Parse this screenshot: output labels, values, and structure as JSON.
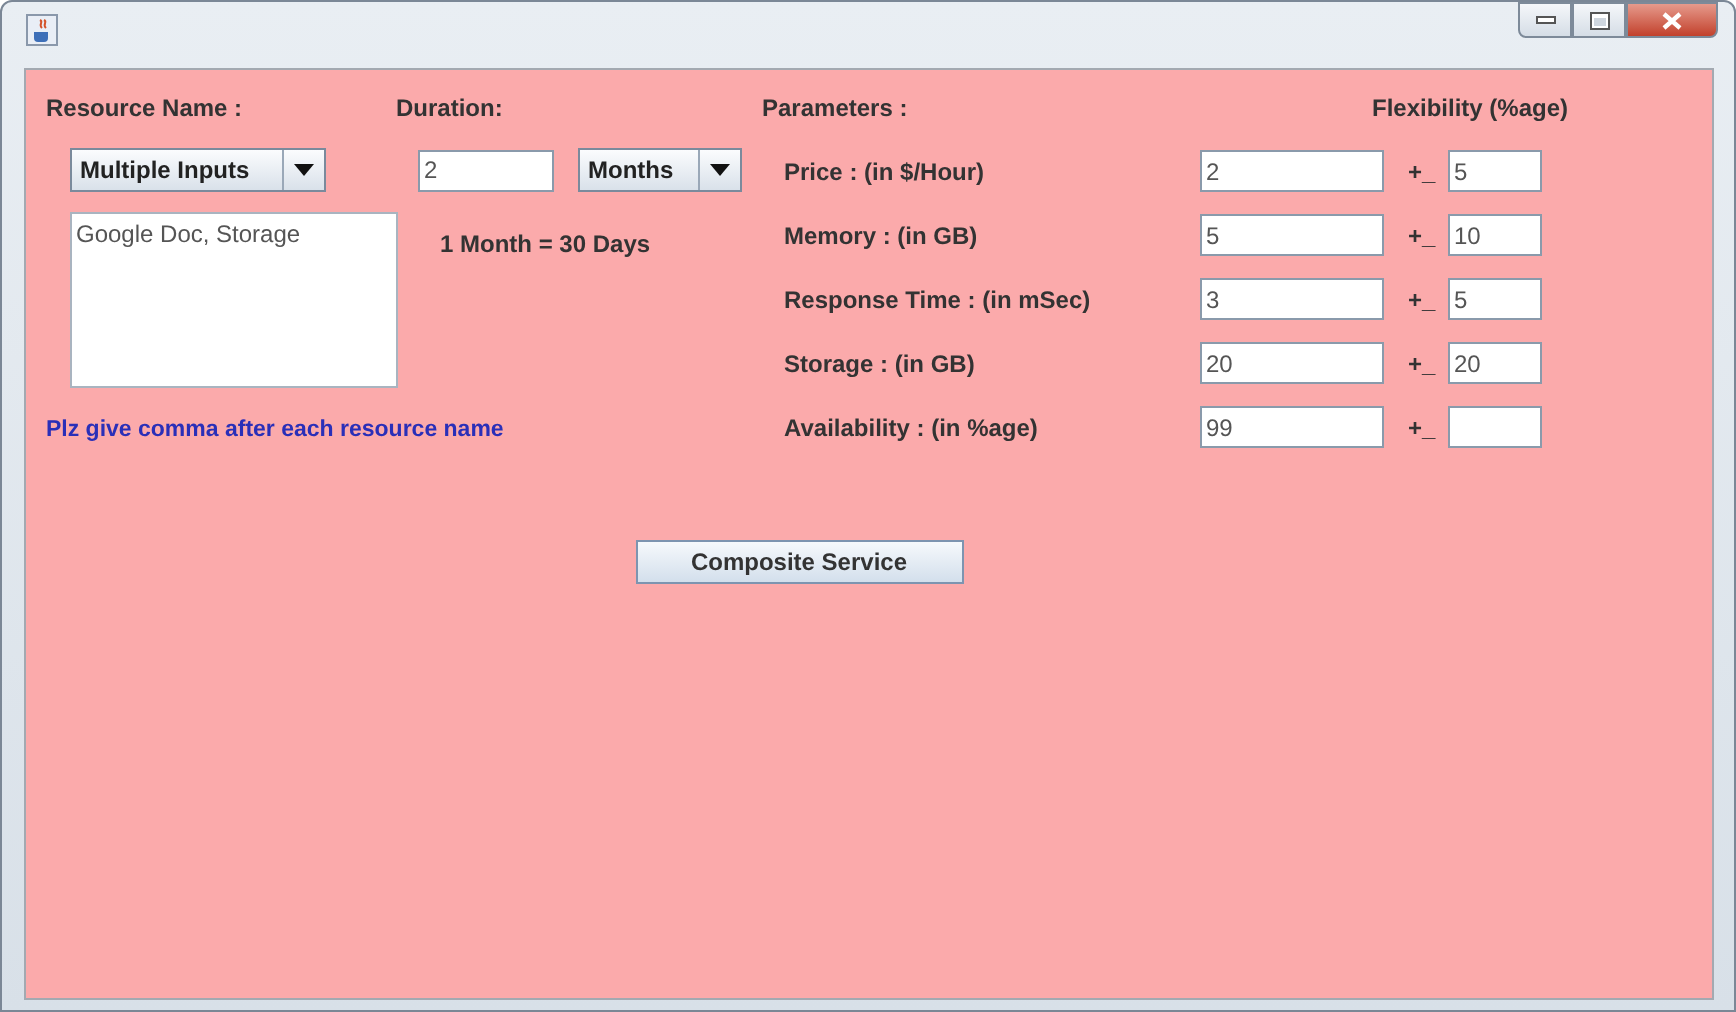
{
  "resource": {
    "label": "Resource Name :",
    "selector": "Multiple Inputs",
    "names": "Google Doc, Storage",
    "hint": "Plz give comma after each resource name"
  },
  "duration": {
    "label": "Duration:",
    "value": "2",
    "unit": "Months",
    "note": "1 Month = 30 Days"
  },
  "parameters": {
    "label": "Parameters :",
    "flexibility_label": "Flexibility (%age)",
    "rows": [
      {
        "label": "Price : (in $/Hour)",
        "value": "2",
        "sign": "+_",
        "flexibility": "5"
      },
      {
        "label": "Memory : (in GB)",
        "value": "5",
        "sign": "+_",
        "flexibility": "10"
      },
      {
        "label": "Response Time : (in mSec)",
        "value": "3",
        "sign": "+_",
        "flexibility": "5"
      },
      {
        "label": "Storage : (in GB)",
        "value": "20",
        "sign": "+_",
        "flexibility": "20"
      },
      {
        "label": "Availability : (in %age)",
        "value": "99",
        "sign": "+_"
      }
    ]
  },
  "button": "Composite Service"
}
